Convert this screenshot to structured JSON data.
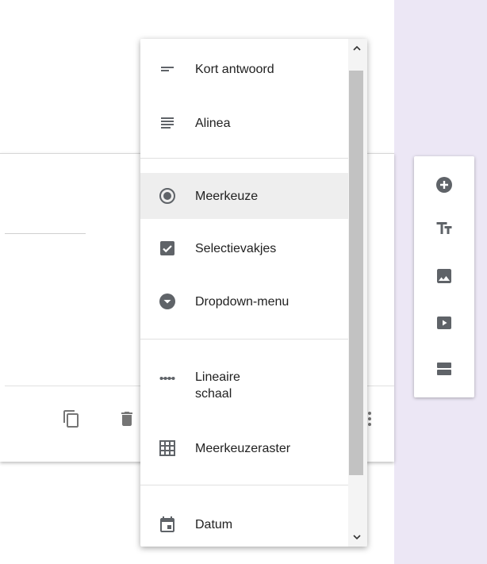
{
  "menu": {
    "items": [
      {
        "label": "Kort antwoord",
        "icon": "short-answer-icon"
      },
      {
        "label": "Alinea",
        "icon": "paragraph-icon"
      },
      {
        "label": "Meerkeuze",
        "icon": "radio-button-icon",
        "selected": true
      },
      {
        "label": "Selectievakjes",
        "icon": "checkbox-icon"
      },
      {
        "label": "Dropdown-menu",
        "icon": "dropdown-icon"
      },
      {
        "label": "Lineaire\nschaal",
        "icon": "linear-scale-icon"
      },
      {
        "label": "Meerkeuzeraster",
        "icon": "grid-icon"
      },
      {
        "label": "Datum",
        "icon": "calendar-icon"
      }
    ]
  },
  "toolbar": {
    "buttons": [
      "add-question-icon",
      "title-text-icon",
      "image-icon",
      "video-icon",
      "section-icon"
    ]
  },
  "card": {
    "footer_icons": [
      "copy-icon",
      "delete-icon"
    ]
  },
  "colors": {
    "icon": "#5f6368",
    "background_accent": "#ece7f5",
    "selected_row": "#eeeeee"
  }
}
